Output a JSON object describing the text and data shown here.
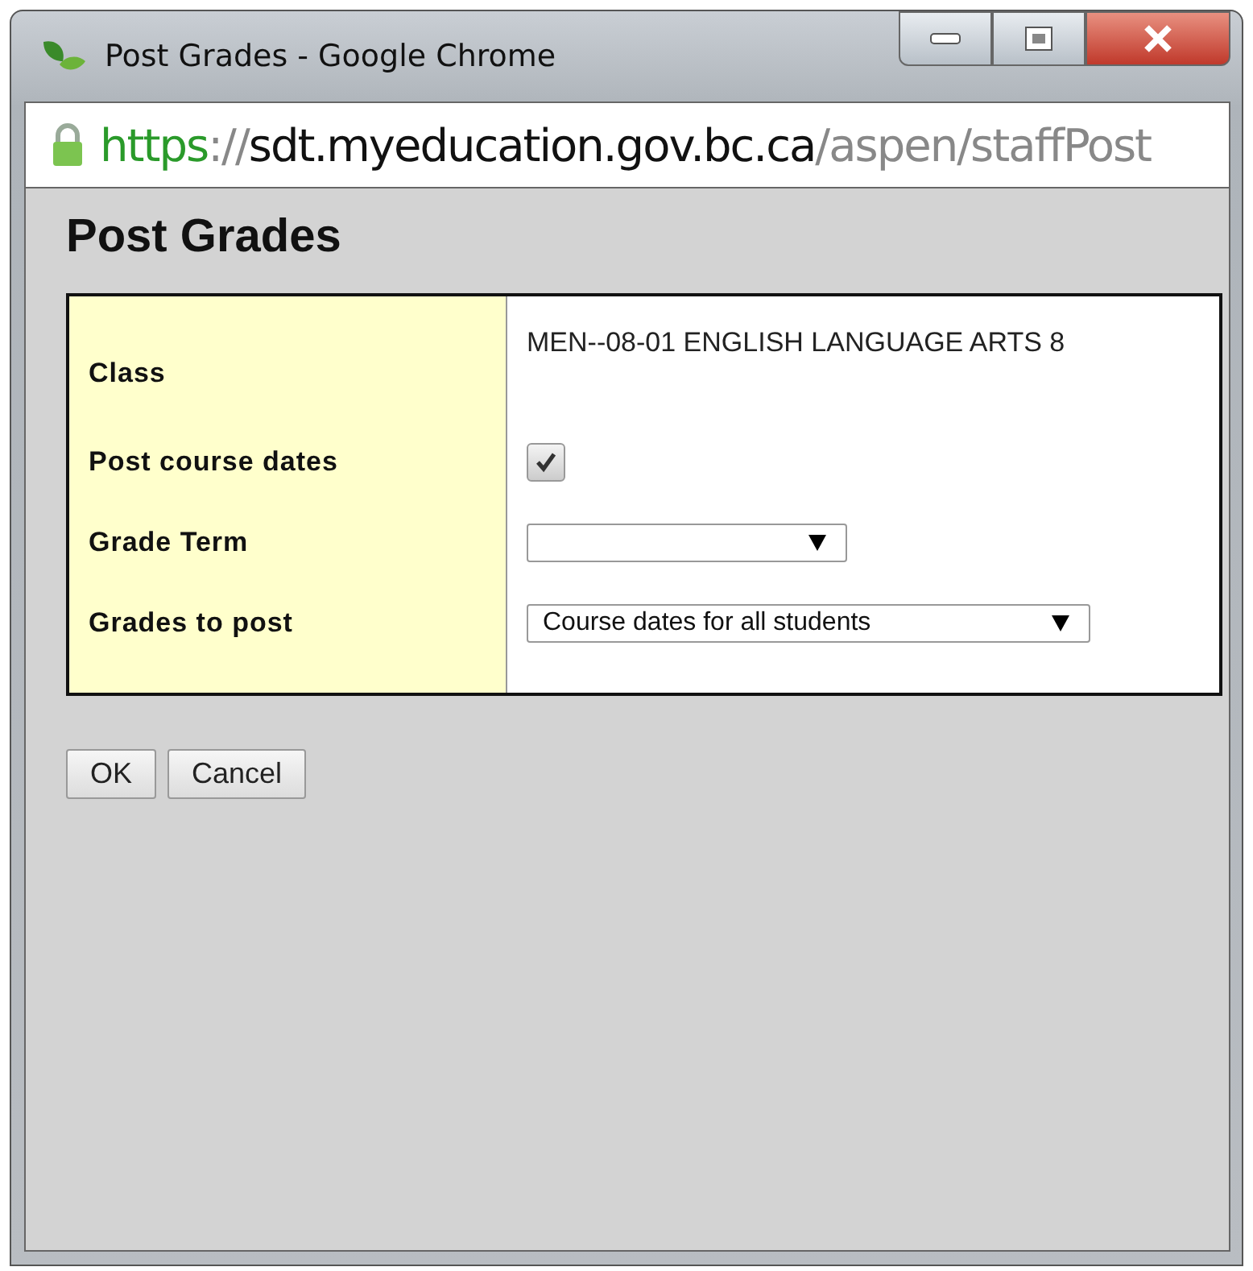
{
  "window": {
    "title": "Post Grades - Google Chrome"
  },
  "address_bar": {
    "scheme": "https",
    "separator": "://",
    "host": "sdt.myeducation.gov.bc.ca",
    "path": "/aspen/staffPost"
  },
  "page": {
    "heading": "Post Grades",
    "rows": [
      {
        "kind": "text",
        "label": "Class",
        "value": "MEN--08-01  ENGLISH LANGUAGE ARTS 8"
      },
      {
        "kind": "checkbox",
        "label": "Post course dates",
        "checked": true
      },
      {
        "kind": "select",
        "label": "Grade Term",
        "value": ""
      },
      {
        "kind": "select",
        "label": "Grades to post",
        "value": "Course dates for all students"
      }
    ],
    "buttons": [
      "OK",
      "Cancel"
    ]
  }
}
